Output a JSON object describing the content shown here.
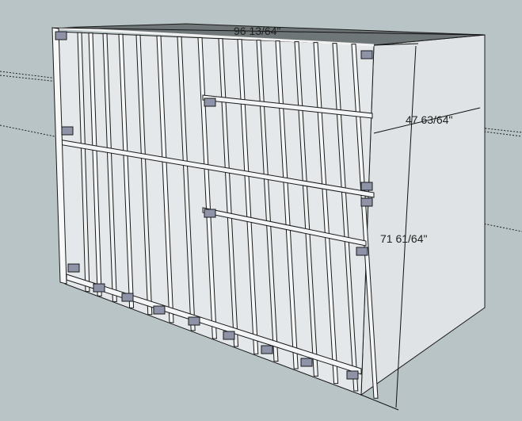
{
  "colors": {
    "background": "#b9c4c6",
    "panel_face": "#e4e8ea",
    "panel_shadow": "#cdd3d6",
    "side_face": "#dfe3e5",
    "top_face": "#6f7678",
    "edge": "#1a1a1a",
    "cleat": "#8e93a8",
    "dimension_line": "#111111"
  },
  "dimensions": {
    "width": "96 13/64\"",
    "depth": "47 63/64\"",
    "height": "71 61/64\""
  }
}
